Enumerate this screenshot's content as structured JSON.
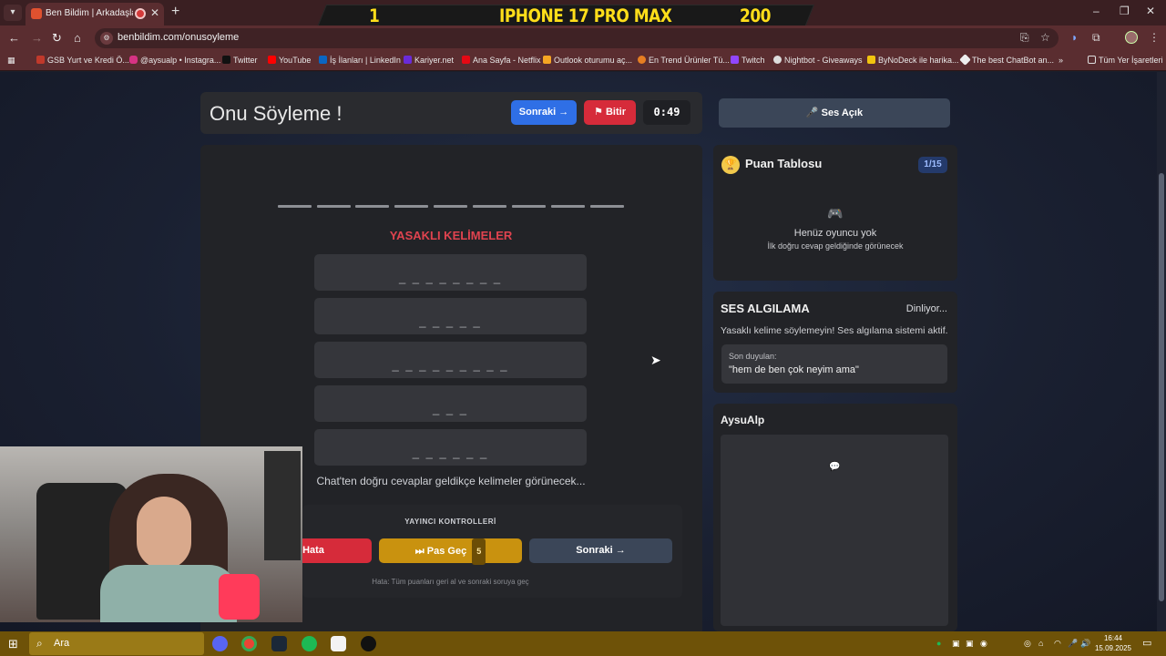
{
  "browser": {
    "tab_title": "Ben Bildim | Arkadaşlarınla",
    "url": "benbildim.com/onusoyleme",
    "bookmarks": [
      {
        "label": "GSB Yurt ve Kredi Ö..."
      },
      {
        "label": "@aysualp • Instagra..."
      },
      {
        "label": "Twitter"
      },
      {
        "label": "YouTube"
      },
      {
        "label": "İş İlanları | LinkedIn"
      },
      {
        "label": "Kariyer.net"
      },
      {
        "label": "Ana Sayfa - Netflix"
      },
      {
        "label": "Outlook oturumu aç..."
      },
      {
        "label": "En Trend Ürünler Tü..."
      },
      {
        "label": "Twitch"
      },
      {
        "label": "Nightbot - Giveaways"
      },
      {
        "label": "ByNoDeck ile harika..."
      },
      {
        "label": "The best ChatBot an..."
      }
    ],
    "all_bookmarks": "Tüm Yer İşaretleri"
  },
  "overlay_banner": {
    "left": "1",
    "center": "IPHONE 17 PRO MAX",
    "right": "200"
  },
  "game": {
    "title": "Onu Söyleme !",
    "next_label": "Sonraki",
    "finish_label": "Bitir",
    "timer": "0:49",
    "sound_label": "Ses Açık",
    "answer_slots": 9,
    "forbidden_title": "YASAKLI KELİMELER",
    "forbidden_words": [
      "_ _ _ _ _ _ _ _",
      "_ _ _ _ _",
      "_ _ _ _ _ _ _ _ _",
      "_ _ _",
      "_ _ _ _ _ _"
    ],
    "chat_note": "Chat'ten doğru cevaplar geldikçe kelimeler görünecek...",
    "controls": {
      "title": "YAYINCI KONTROLLERİ",
      "error_label": "Hata",
      "pass_label": "Pas Geç",
      "pass_count": "5",
      "next_label": "Sonraki",
      "hint": "Hata: Tüm puanları geri al ve sonraki soruya geç"
    }
  },
  "scoreboard": {
    "title": "Puan Tablosu",
    "count": "1/15",
    "empty_title": "Henüz oyuncu yok",
    "empty_sub": "İlk doğru cevap geldiğinde görünecek"
  },
  "voice": {
    "title": "SES ALGILAMA",
    "status": "Dinliyor...",
    "desc": "Yasaklı kelime söylemeyin! Ses algılama sistemi aktif.",
    "last_heard_label": "Son duyulan:",
    "last_heard": "\"hem de ben çok neyim ama\""
  },
  "chat": {
    "title": "AysuAlp"
  },
  "taskbar": {
    "search_placeholder": "Ara",
    "time": "16:44",
    "date": "15.09.2025"
  },
  "colors": {
    "accent_blue": "#2f6fe6",
    "danger_red": "#d62b3a",
    "gold": "#c9920f",
    "banner_yellow": "#ffde1a"
  }
}
